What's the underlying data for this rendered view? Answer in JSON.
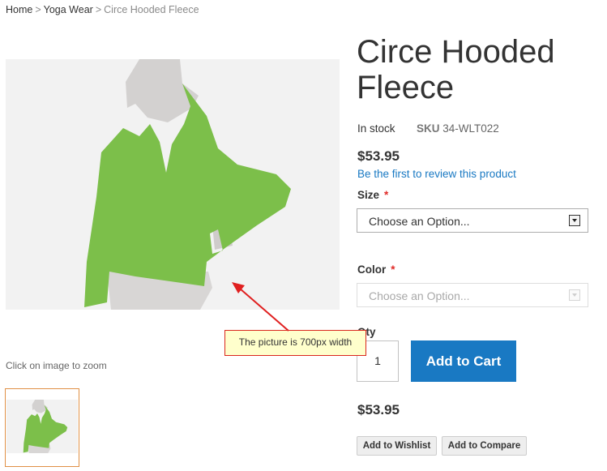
{
  "breadcrumb": {
    "items": [
      "Home",
      "Yoga Wear"
    ],
    "separator": ">",
    "current": "Circe Hooded Fleece"
  },
  "product": {
    "title": "Circe Hooded Fleece",
    "stock": "In stock",
    "sku_label": "SKU",
    "sku": "34-WLT022",
    "price": "$53.95",
    "review_link": "Be the first to review this product",
    "zoom_hint": "Click on image to zoom"
  },
  "options": {
    "size": {
      "label": "Size",
      "required_mark": "*",
      "value": "Choose an Option..."
    },
    "color": {
      "label": "Color",
      "required_mark": "*",
      "value": "Choose an Option..."
    }
  },
  "cart": {
    "qty_label": "Qty",
    "qty": "1",
    "add_to_cart": "Add to Cart"
  },
  "footer": {
    "price": "$53.95",
    "wishlist": "Add to Wishlist",
    "compare": "Add to Compare"
  },
  "annotation": {
    "callout": "The picture is 700px width"
  },
  "colors": {
    "link": "#1979c3",
    "button": "#1979c3",
    "required": "#e02b27",
    "annotation_border": "#d9271d",
    "annotation_fill": "#ffffcc",
    "thumb_border": "#e09045",
    "garment": "#7cbf4a"
  }
}
